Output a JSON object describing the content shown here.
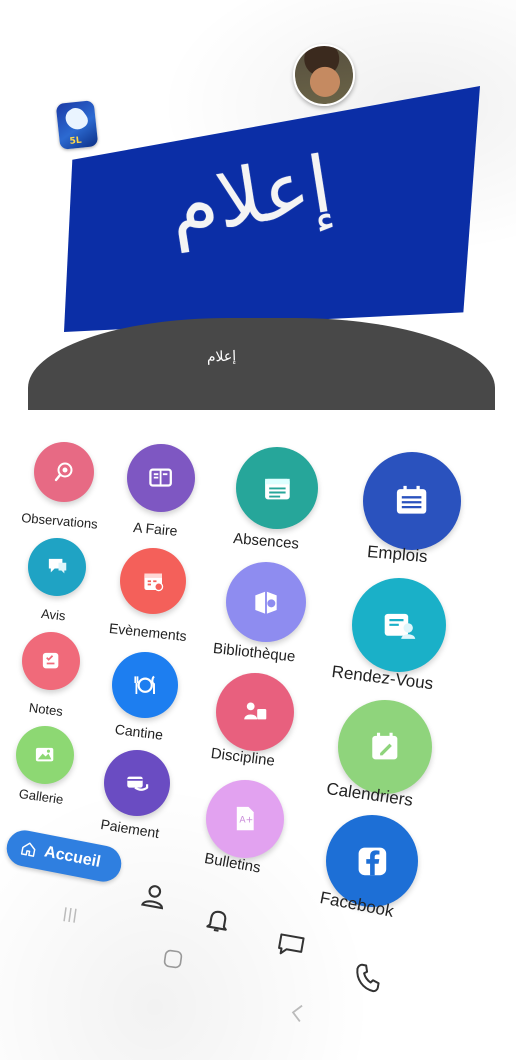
{
  "header": {
    "logo_text": "5L",
    "banner_title": "إعلام",
    "caption": "إعلام"
  },
  "tiles": [
    {
      "label": "Observations",
      "color": "#e76a84",
      "icon": "observation-icon"
    },
    {
      "label": "A Faire",
      "color": "#7e57c2",
      "icon": "book-icon"
    },
    {
      "label": "Absences",
      "color": "#26a69a",
      "icon": "calendar-list-icon"
    },
    {
      "label": "Emplois",
      "color": "#2a52be",
      "icon": "timetable-icon"
    },
    {
      "label": "Avis",
      "color": "#1fa3c4",
      "icon": "speech-bubble-icon"
    },
    {
      "label": "Evènements",
      "color": "#f4605a",
      "icon": "event-calendar-icon"
    },
    {
      "label": "Bibliothèque",
      "color": "#8e8cf0",
      "icon": "library-icon"
    },
    {
      "label": "Rendez-Vous",
      "color": "#1ab0c8",
      "icon": "appointment-icon"
    },
    {
      "label": "Notes",
      "color": "#f06a7a",
      "icon": "notes-icon"
    },
    {
      "label": "Cantine",
      "color": "#1d7ef0",
      "icon": "cutlery-icon"
    },
    {
      "label": "Discipline",
      "color": "#e8607e",
      "icon": "discipline-icon"
    },
    {
      "label": "Calendriers",
      "color": "#8fd47c",
      "icon": "calendar-edit-icon"
    },
    {
      "label": "Gallerie",
      "color": "#8dd873",
      "icon": "gallery-icon"
    },
    {
      "label": "Paiement",
      "color": "#6a4cc2",
      "icon": "payment-icon"
    },
    {
      "label": "Bulletins",
      "color": "#e2a2f0",
      "icon": "report-card-icon"
    },
    {
      "label": "Facebook",
      "color": "#1d6fd6",
      "icon": "facebook-icon"
    }
  ],
  "nav": {
    "home_label": "Accueil",
    "items": [
      "home-icon",
      "profile-icon",
      "bell-icon",
      "chat-icon",
      "phone-icon"
    ]
  }
}
